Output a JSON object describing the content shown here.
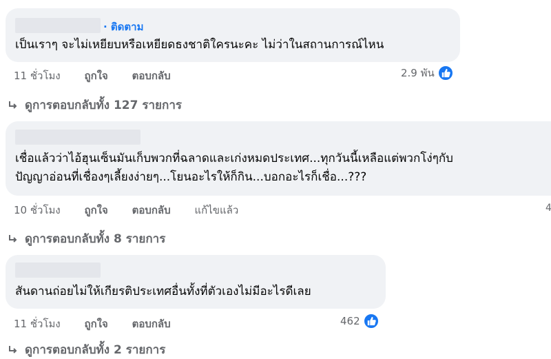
{
  "comments": [
    {
      "follow_label": "· ติดตาม",
      "text_lines": [
        "เป็นเราๆ จะไม่เหยียบหรือเหยียดธงชาติใครนะคะ ไม่ว่าในสถานการณ์ไหน"
      ],
      "time": "11 ชั่วโมง",
      "like_action": "ถูกใจ",
      "reply_action": "ตอบกลับ",
      "reaction_count": "2.9 พัน",
      "replies_label": "ดูการตอบกลับทั้ง 127 รายการ"
    },
    {
      "text_lines": [
        "เชื่อแล้วว่าไอ้ฮุนเซ็นมันเก็บพวกที่ฉลาดและเก่งหมดประเทศ...ทุกวันนี้เหลือแต่พวกโง่ๆกับ",
        "ปัญญาอ่อนที่เชื่องๆเลี้ยงง่ายๆ...โยนอะไรให้ก็กิน...บอกอะไรก็เชื่อ...???"
      ],
      "time": "10 ชั่วโมง",
      "like_action": "ถูกใจ",
      "reply_action": "ตอบกลับ",
      "edited": "แก้ไขแล้ว",
      "edge_count": "4",
      "replies_label": "ดูการตอบกลับทั้ง 8 รายการ"
    },
    {
      "text_lines": [
        "สันดานถ่อยไม่ให้เกียรติประเทศอื่นทั้งที่ตัวเองไม่มีอะไรดีเลย"
      ],
      "time": "11 ชั่วโมง",
      "like_action": "ถูกใจ",
      "reply_action": "ตอบกลับ",
      "reaction_count": "462",
      "replies_label": "ดูการตอบกลับทั้ง 2 รายการ"
    }
  ],
  "icons": {
    "reaction": "like-icon",
    "replies": "reply-arrow-icon"
  },
  "colors": {
    "accent": "#1877f2",
    "bubble": "#f0f2f5",
    "muted": "#65676b"
  }
}
